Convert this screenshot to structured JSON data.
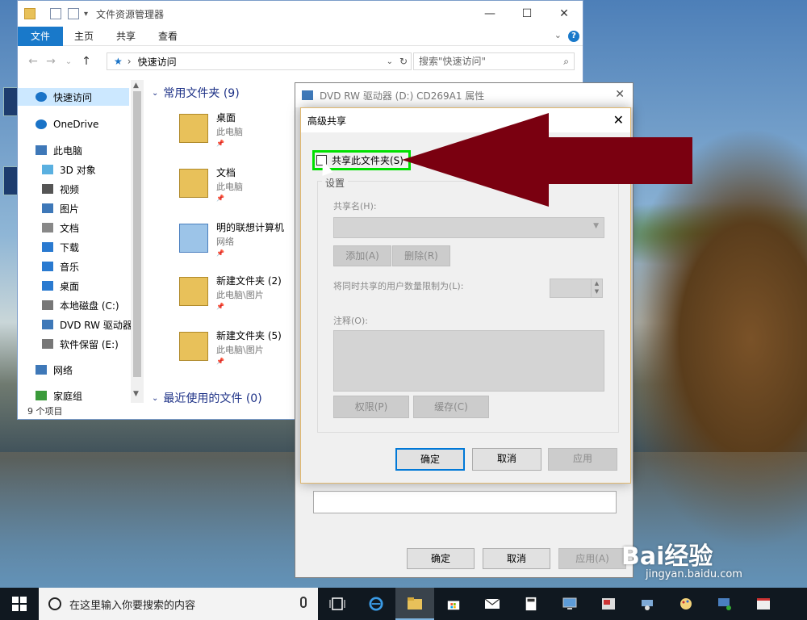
{
  "explorer": {
    "title": "文件资源管理器",
    "tabs": {
      "file": "文件",
      "home": "主页",
      "share": "共享",
      "view": "查看"
    },
    "address": "快速访问",
    "search_placeholder": "搜索\"快速访问\"",
    "status": "9 个项目",
    "nav": [
      {
        "label": "快速访问",
        "icon": "star-icon"
      },
      {
        "label": "OneDrive",
        "icon": "cloud-icon"
      },
      {
        "label": "此电脑",
        "icon": "computer-icon"
      },
      {
        "label": "3D 对象",
        "icon": "cube-icon"
      },
      {
        "label": "视频",
        "icon": "video-icon"
      },
      {
        "label": "图片",
        "icon": "picture-icon"
      },
      {
        "label": "文档",
        "icon": "document-icon"
      },
      {
        "label": "下载",
        "icon": "download-icon"
      },
      {
        "label": "音乐",
        "icon": "music-icon"
      },
      {
        "label": "桌面",
        "icon": "desktop-icon"
      },
      {
        "label": "本地磁盘 (C:)",
        "icon": "drive-icon"
      },
      {
        "label": "DVD RW 驱动器",
        "icon": "dvd-icon"
      },
      {
        "label": "软件保留 (E:)",
        "icon": "drive-icon"
      },
      {
        "label": "网络",
        "icon": "network-icon"
      },
      {
        "label": "家庭组",
        "icon": "homegroup-icon"
      }
    ],
    "frequent_header": "常用文件夹 (9)",
    "recent_header": "最近使用的文件 (0)",
    "items": [
      {
        "name": "桌面",
        "location": "此电脑"
      },
      {
        "name": "文档",
        "location": "此电脑"
      },
      {
        "name": "明的联想计算机",
        "location": "网络"
      },
      {
        "name": "新建文件夹 (2)",
        "location": "此电脑\\图片"
      },
      {
        "name": "新建文件夹 (5)",
        "location": "此电脑\\图片"
      }
    ]
  },
  "properties": {
    "title": "DVD RW 驱动器 (D:) CD269A1 属性",
    "ok": "确定",
    "cancel": "取消",
    "apply": "应用(A)"
  },
  "advanced_sharing": {
    "title": "高级共享",
    "share_checkbox": "共享此文件夹(S)",
    "share_checked": false,
    "settings": "设置",
    "share_name_label": "共享名(H):",
    "add_button": "添加(A)",
    "remove_button": "删除(R)",
    "limit_label": "将同时共享的用户数量限制为(L):",
    "comment_label": "注释(O):",
    "permissions_button": "权限(P)",
    "cache_button": "缓存(C)",
    "ok": "确定",
    "cancel": "取消",
    "apply": "应用"
  },
  "taskbar": {
    "search_placeholder": "在这里输入你要搜索的内容"
  },
  "watermark": {
    "brand": "Bai经验",
    "url": "jingyan.baidu.com"
  },
  "colors": {
    "accent": "#1979ca",
    "highlight": "#00e000",
    "arrow": "#7a0010"
  }
}
